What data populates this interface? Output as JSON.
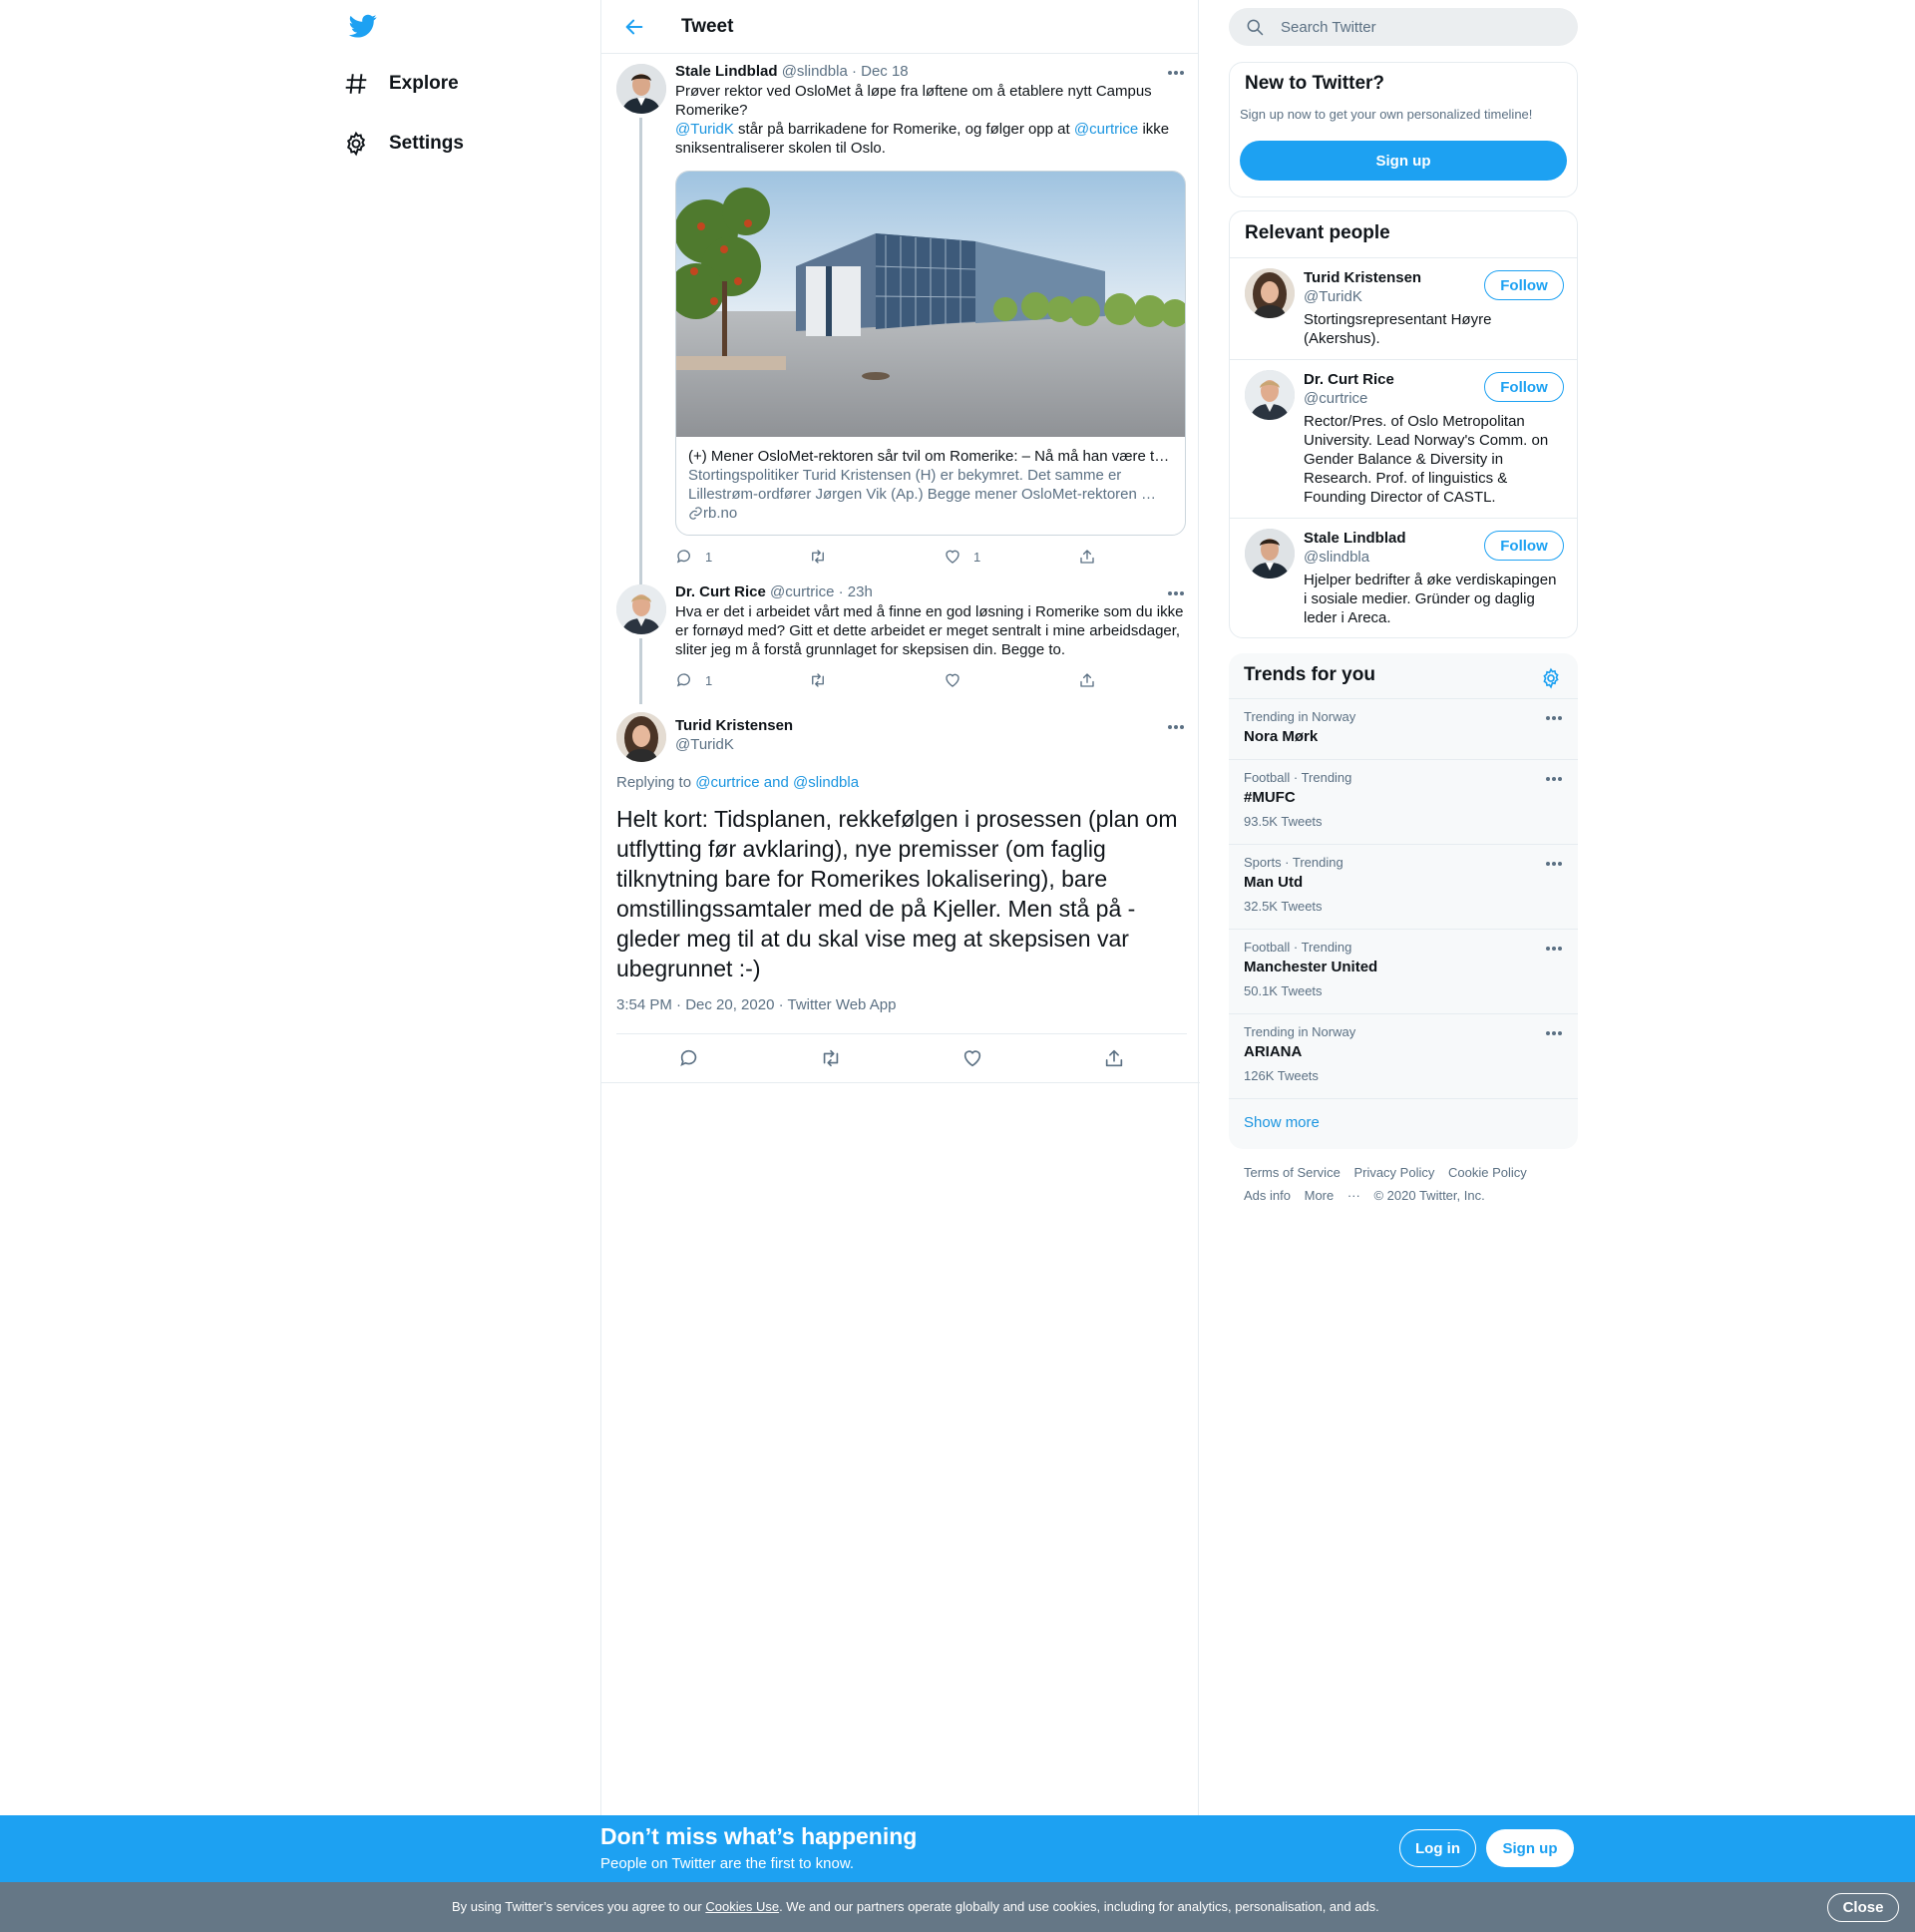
{
  "nav": {
    "explore": "Explore",
    "settings": "Settings"
  },
  "header": {
    "title": "Tweet"
  },
  "tweet1": {
    "name": "Stale Lindblad",
    "handle": "@slindbla",
    "date": "· Dec 18",
    "text_line1": "Prøver rektor ved OsloMet å løpe fra løftene om å etablere nytt Campus Romerike?",
    "mention1": "@TuridK",
    "text_mid": " står på barrikadene for Romerike, og følger opp at ",
    "mention2": "@curtrice",
    "text_end": " ikke sniksentraliserer skolen til Oslo.",
    "card": {
      "title": "(+) Mener OsloMet-rektoren sår tvil om Romerike: – Nå må han være t…",
      "description": "Stortingspolitiker Turid Kristensen (H) er bekymret. Det samme er Lillestrøm-ordfører Jørgen Vik (Ap.) Begge mener OsloMet-rektoren …",
      "domain": "rb.no"
    },
    "reply_count": "1",
    "like_count": "1"
  },
  "tweet2": {
    "name": "Dr. Curt Rice",
    "handle": "@curtrice",
    "date": "· 23h",
    "text": "Hva er det i arbeidet vårt med å finne en god løsning i Romerike som du ikke er fornøyd med? Gitt et dette arbeidet er meget sentralt i mine arbeidsdager, sliter jeg m å forstå grunnlaget for skepsisen din. Begge to.",
    "reply_count": "1"
  },
  "main_tweet": {
    "name": "Turid Kristensen",
    "handle": "@TuridK",
    "replying_prefix": "Replying to ",
    "replying_to": "@curtrice and @slindbla",
    "text": "Helt kort: Tidsplanen, rekkefølgen i prosessen (plan om utflytting før avklaring), nye premisser (om faglig tilknytning bare for Romerikes lokalisering), bare omstillingssamtaler med de på Kjeller. Men stå på - gleder meg til at du skal vise meg at skepsisen var ubegrunnet :-)",
    "timestamp": "3:54 PM · Dec 20, 2020 · Twitter Web App"
  },
  "search": {
    "placeholder": "Search Twitter"
  },
  "new_to_twitter": {
    "title": "New to Twitter?",
    "subtitle": "Sign up now to get your own personalized timeline!",
    "signup": "Sign up"
  },
  "relevant": {
    "title": "Relevant people",
    "people": [
      {
        "name": "Turid Kristensen",
        "handle": "@TuridK",
        "bio": "Stortingsrepresentant Høyre (Akershus).",
        "follow": "Follow"
      },
      {
        "name": "Dr. Curt Rice",
        "handle": "@curtrice",
        "bio": "Rector/Pres. of Oslo Metropolitan University. Lead Norway's Comm. on Gender Balance & Diversity in Research. Prof. of linguistics & Founding Director of CASTL.",
        "follow": "Follow"
      },
      {
        "name": "Stale Lindblad",
        "handle": "@slindbla",
        "bio": "Hjelper bedrifter å øke verdiskapingen i sosiale medier. Gründer og daglig leder i Areca.",
        "follow": "Follow"
      }
    ]
  },
  "trends": {
    "title": "Trends for you",
    "items": [
      {
        "context": "Trending in Norway",
        "name": "Nora Mørk",
        "count": ""
      },
      {
        "context": "Football · Trending",
        "name": "#MUFC",
        "count": "93.5K Tweets"
      },
      {
        "context": "Sports · Trending",
        "name": "Man Utd",
        "count": "32.5K Tweets"
      },
      {
        "context": "Football · Trending",
        "name": "Manchester United",
        "count": "50.1K Tweets"
      },
      {
        "context": "Trending in Norway",
        "name": "ARIANA",
        "count": "126K Tweets"
      }
    ],
    "show_more": "Show more"
  },
  "footer": {
    "terms": "Terms of Service",
    "privacy": "Privacy Policy",
    "cookie": "Cookie Policy",
    "ads": "Ads info",
    "more": "More",
    "copyright": "© 2020 Twitter, Inc."
  },
  "banner": {
    "title": "Don’t miss what’s happening",
    "subtitle": "People on Twitter are the first to know.",
    "login": "Log in",
    "signup": "Sign up"
  },
  "cookie_bar": {
    "text_before": "By using Twitter’s services you agree to our ",
    "link": "Cookies Use",
    "text_after": ". We and our partners operate globally and use cookies, including for analytics, personalisation, and ads.",
    "close": "Close"
  },
  "colors": {
    "accent": "#1da1f2",
    "link": "#1b95e0",
    "secondary_text": "#5b7083",
    "cookie_bar": "#657786"
  }
}
